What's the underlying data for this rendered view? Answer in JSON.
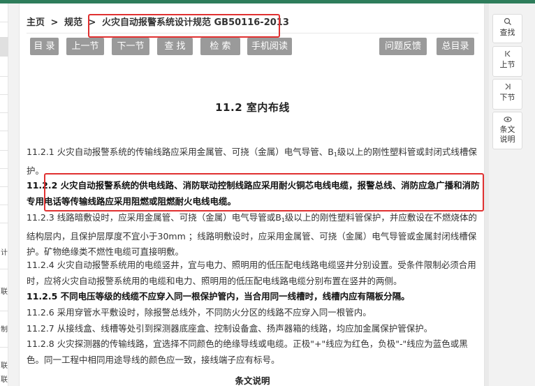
{
  "breadcrumb": {
    "home": "主页",
    "sep1": ">",
    "section": "规范",
    "sep2": ">",
    "current": "火灾自动报警系统设计规范 GB50116-2013"
  },
  "toolbar": {
    "toc": "目 录",
    "prev": "上一节",
    "next": "下一节",
    "find": "查 找",
    "search": "检 索",
    "mobile": "手机阅读",
    "feedback": "问题反馈",
    "master_toc": "总目录"
  },
  "title": "11.2 室内布线",
  "paragraphs": {
    "p1_a": "11.2.1 火灾自动报警系统的传输线路应采用金属管、可挠（金属）电气导管、B",
    "p1_sub": "1",
    "p1_b": "级以上的刚性塑料管或封闭式线槽保护。",
    "p2": "11.2.2 火灾自动报警系统的供电线路、消防联动控制线路应采用耐火铜芯电线电缆，报警总线、消防应急广播和消防专用电话等传输线路应采用阻燃或阻燃耐火电线电缆。",
    "p3_a": "11.2.3 线路暗敷设时，应采用金属管、可挠（金属）电气导管或B",
    "p3_sub": "1",
    "p3_b": "级以上的刚性塑料管保护，并应敷设在不燃烧体的结构层内，且保护层厚度不宜小于30mm ；线路明敷设时，应采用金属管、可挠（金属）电气导管或金属封闭线槽保护。矿物绝缘类不燃性电缆可直接明敷。",
    "p4": "11.2.4 火灾自动报警系统用的电缆竖井，宜与电力、照明用的低压配电线路电缆竖井分别设置。受条件限制必须合用时，应将火灾自动报警系统用的电缆和电力、照明用的低压配电线路电缆分别布置在竖井的两侧。",
    "p5": "11.2.5 不同电压等级的线缆不应穿入同一根保护管内，当合用同一线槽时，线槽内应有隔板分隔。",
    "p6": "11.2.6 采用穿管水平敷设时，除报警总线外，不同防火分区的线路不应穿入同一根管内。",
    "p7": "11.2.7 从接线盒、线槽等处引到探测器底座盒、控制设备盒、扬声器箱的线路，均应加金属保护管保护。",
    "p8": "11.2.8 火灾探测器的传输线路，宜选择不同颜色的绝缘导线或电缆。正极\"+\"线应为红色，负极\"-\"线应为蓝色或黑色。同一工程中相同用途导线的颜色应一致，接线端子应有标号。"
  },
  "article_heading": "条文说明",
  "left_strip": {
    "labels": [
      "计",
      "联",
      "制",
      "联",
      "联"
    ]
  },
  "sidebar": {
    "find": "查找",
    "up": "上节",
    "down": "下节",
    "explain": "条文说明"
  },
  "colors": {
    "accent_bar": "#2e7d5b",
    "button_bg": "#9a9a9a",
    "highlight_box": "#e03030"
  },
  "icons": {
    "find": "search-icon",
    "up": "skip-up-icon",
    "down": "skip-down-icon",
    "explain": "eye-icon"
  }
}
